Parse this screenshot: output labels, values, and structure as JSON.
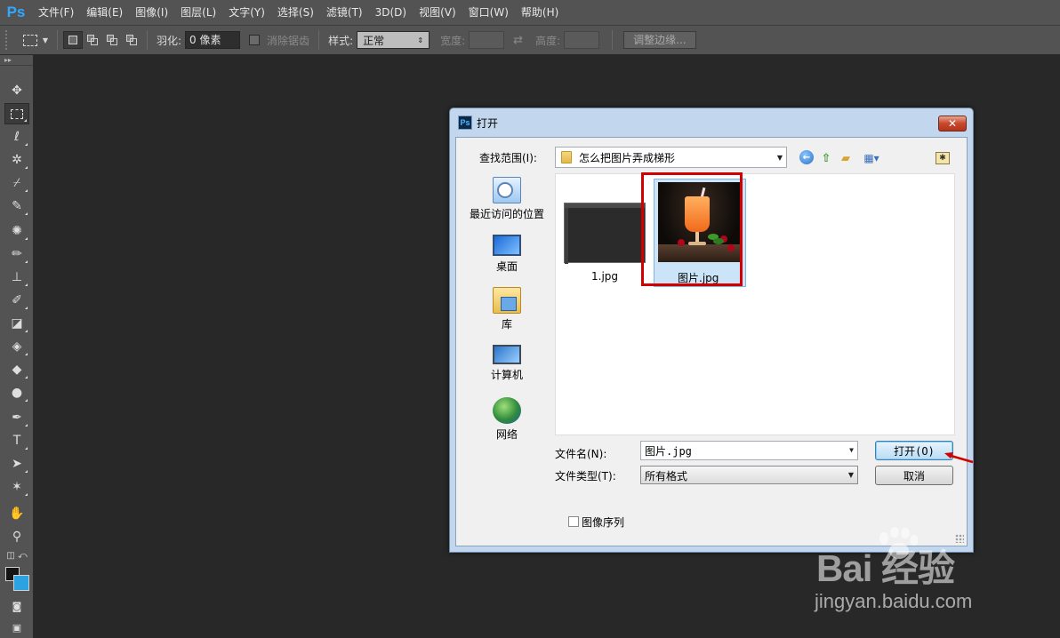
{
  "app": {
    "logo": "Ps"
  },
  "menu": [
    "文件(F)",
    "编辑(E)",
    "图像(I)",
    "图层(L)",
    "文字(Y)",
    "选择(S)",
    "滤镜(T)",
    "3D(D)",
    "视图(V)",
    "窗口(W)",
    "帮助(H)"
  ],
  "options": {
    "feather_label": "羽化:",
    "feather_value": "0 像素",
    "antialias_label": "消除锯齿",
    "style_label": "样式:",
    "style_value": "正常",
    "width_label": "宽度:",
    "height_label": "高度:",
    "refine_edge_label": "调整边缘..."
  },
  "toolbar": {
    "tools": [
      "move-tool",
      "marquee-tool",
      "lasso-tool",
      "magic-wand-tool",
      "crop-tool",
      "eyedropper-tool",
      "healing-tool",
      "brush-tool",
      "clone-stamp-tool",
      "history-brush-tool",
      "eraser-tool",
      "paint-bucket-tool",
      "blur-tool",
      "dodge-tool",
      "pen-tool",
      "type-tool",
      "path-selection-tool",
      "custom-shape-tool",
      "hand-tool",
      "zoom-tool"
    ],
    "foreground_color": "#141414",
    "background_color": "#2aa3e0"
  },
  "dialog": {
    "title": "打开",
    "icon_text": "Ps",
    "look_in_label": "查找范围(I):",
    "look_in_value": "怎么把图片弄成梯形",
    "places": [
      {
        "label": "最近访问的位置",
        "icon": "recent-places-icon"
      },
      {
        "label": "桌面",
        "icon": "desktop-icon"
      },
      {
        "label": "库",
        "icon": "libraries-icon"
      },
      {
        "label": "计算机",
        "icon": "computer-icon"
      },
      {
        "label": "网络",
        "icon": "network-icon"
      }
    ],
    "files": [
      {
        "name": "1.jpg",
        "selected": false
      },
      {
        "name": "图片.jpg",
        "selected": true
      }
    ],
    "file_name_label": "文件名(N):",
    "file_name_value": "图片.jpg",
    "file_type_label": "文件类型(T):",
    "file_type_value": "所有格式",
    "open_button": "打开(O)",
    "cancel_button": "取消",
    "image_sequence_label": "图像序列",
    "image_sequence_checked": false,
    "highlight_color": "#d20000"
  },
  "watermark": {
    "brand": "Bai 经验",
    "url": "jingyan.baidu.com"
  }
}
